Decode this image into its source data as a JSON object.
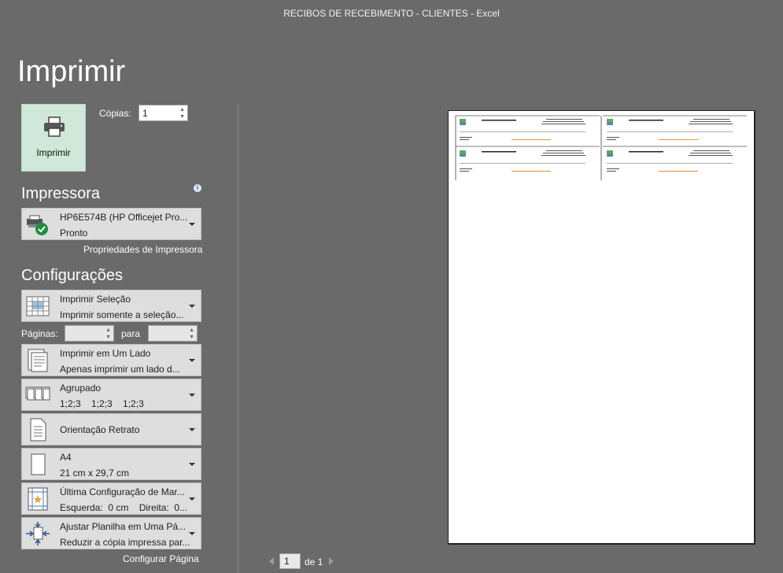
{
  "window": {
    "title": "RECIBOS DE RECEBIMENTO - CLIENTES - Excel"
  },
  "page_title": "Imprimir",
  "print_button": {
    "label": "Imprimir",
    "icon": "printer-icon"
  },
  "copies": {
    "label": "Cópias:",
    "value": "1"
  },
  "printer": {
    "heading": "Impressora",
    "info_icon": "i",
    "name": "HP6E574B (HP Officejet Pro...",
    "status": "Pronto",
    "properties_link": "Propriedades de Impressora"
  },
  "settings": {
    "heading": "Configurações",
    "print_what": {
      "title": "Imprimir Seleção",
      "subtitle": "Imprimir somente a seleção..."
    },
    "pages": {
      "label": "Páginas:",
      "from": "",
      "to_label": "para",
      "to": ""
    },
    "sides": {
      "title": "Imprimir em Um Lado",
      "subtitle": "Apenas imprimir um lado d..."
    },
    "collation": {
      "title": "Agrupado",
      "subtitle": "1;2;3    1;2;3    1;2;3"
    },
    "orientation": {
      "title": "Orientação Retrato"
    },
    "paper": {
      "title": "A4",
      "subtitle": "21 cm x 29,7 cm"
    },
    "margins": {
      "title": "Última Configuração de Mar...",
      "subtitle": "Esquerda:  0 cm    Direita:  0..."
    },
    "scaling": {
      "title": "Ajustar Planilha em Uma Pá...",
      "subtitle": "Reduzir a cópia impressa par..."
    },
    "page_setup_link": "Configurar Página"
  },
  "pager": {
    "current": "1",
    "of_label": "de 1"
  },
  "colors": {
    "background": "#6a6a6a",
    "print_button_bg": "#cfe8d9",
    "dropdown_bg": "#dedede",
    "accent_green": "#1e8e3e"
  }
}
